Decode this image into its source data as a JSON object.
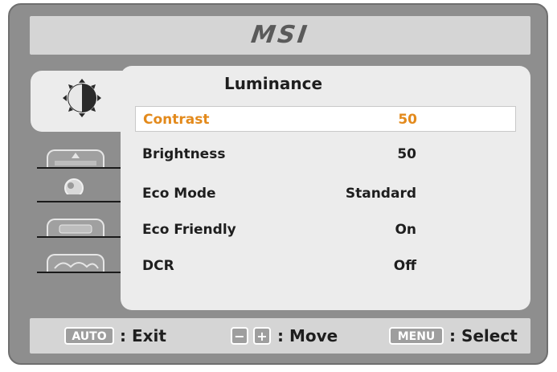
{
  "header": {
    "brand": "MSI"
  },
  "tabs": [
    {
      "name": "Luminance",
      "icon": "luminance-icon",
      "active": true
    },
    {
      "name": "",
      "icon": "image-icon",
      "active": false
    },
    {
      "name": "",
      "icon": "color-icon",
      "active": false
    },
    {
      "name": "",
      "icon": "osd-icon",
      "active": false
    },
    {
      "name": "",
      "icon": "setting-icon",
      "active": false
    }
  ],
  "panel": {
    "title": "Luminance",
    "items": [
      {
        "label": "Contrast",
        "value": "50",
        "selected": true
      },
      {
        "label": "Brightness",
        "value": "50",
        "selected": false
      },
      {
        "label": "Eco Mode",
        "value": "Standard",
        "selected": false
      },
      {
        "label": "Eco Friendly",
        "value": "On",
        "selected": false
      },
      {
        "label": "DCR",
        "value": "Off",
        "selected": false
      }
    ]
  },
  "footer": {
    "auto_key": "AUTO",
    "auto_text": ": Exit",
    "minus_key": "−",
    "plus_key": "+",
    "move_text": ": Move",
    "menu_key": "MENU",
    "select_text": ": Select"
  },
  "colors": {
    "selected": "#e38a1c",
    "frame": "#8e8e8e",
    "panel": "#ececec"
  }
}
